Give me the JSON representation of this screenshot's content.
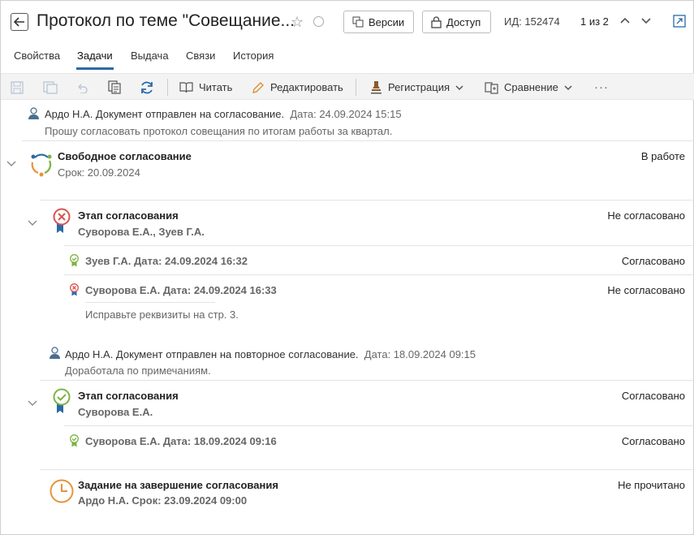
{
  "header": {
    "title": "Протокол по теме \"Совещание...",
    "versions_label": "Версии",
    "access_label": "Доступ",
    "id_text": "ИД: 152474",
    "pager_text": "1 из 2"
  },
  "tabs": [
    "Свойства",
    "Задачи",
    "Выдача",
    "Связи",
    "История"
  ],
  "toolbar": {
    "read_label": "Читать",
    "edit_label": "Редактировать",
    "registration_label": "Регистрация",
    "compare_label": "Сравнение",
    "more_label": "···"
  },
  "feed": {
    "msg1": {
      "author": "Ардо Н.А. Документ отправлен на согласование.",
      "date": "Дата: 24.09.2024 15:15",
      "text": "Прошу согласовать протокол совещания по итогам работы за квартал."
    },
    "approval": {
      "title": "Свободное согласование",
      "deadline": "Срок: 20.09.2024",
      "status": "В работе"
    },
    "stage1": {
      "title": "Этап согласования",
      "people": "Суворова Е.А., Зуев Г.А.",
      "status": "Не согласовано"
    },
    "stage1_r1": {
      "text": "Зуев Г.А. Дата: 24.09.2024 16:32",
      "status": "Согласовано"
    },
    "stage1_r2": {
      "text": "Суворова Е.А. Дата: 24.09.2024 16:33",
      "status": "Не согласовано",
      "comment": "Исправьте реквизиты на стр. 3."
    },
    "msg2": {
      "author": "Ардо Н.А. Документ отправлен на повторное согласование.",
      "date": "Дата: 18.09.2024 09:15",
      "text": "Доработала по примечаниям."
    },
    "stage2": {
      "title": "Этап согласования",
      "people": "Суворова Е.А.",
      "status": "Согласовано"
    },
    "stage2_r1": {
      "text": "Суворова Е.А. Дата: 18.09.2024 09:16",
      "status": "Согласовано"
    },
    "task": {
      "title": "Задание на завершение согласования",
      "detail": "Ардо Н.А. Срок: 23.09.2024 09:00",
      "status": "Не прочитано"
    }
  },
  "colors": {
    "accent": "#2a6aa8",
    "approved": "#7cb342",
    "rejected": "#d9534f",
    "pending": "#e8933a"
  }
}
